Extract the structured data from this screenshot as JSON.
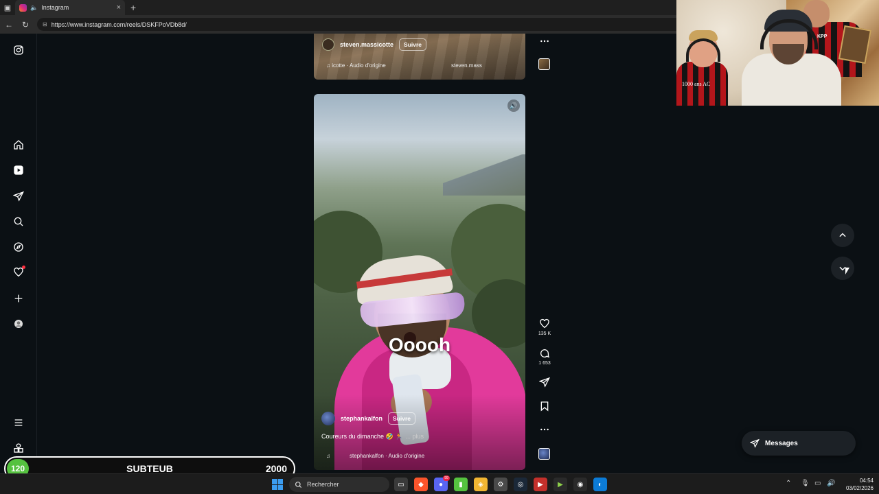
{
  "browser": {
    "tab_title": "Instagram",
    "url": "https://www.instagram.com/reels/DSKFPoVDb8d/"
  },
  "sidebar": {
    "items": [
      {
        "name": "instagram-logo-icon"
      },
      {
        "name": "home-icon"
      },
      {
        "name": "reels-icon"
      },
      {
        "name": "messages-icon"
      },
      {
        "name": "search-icon"
      },
      {
        "name": "explore-icon"
      },
      {
        "name": "notifications-icon"
      },
      {
        "name": "create-icon"
      },
      {
        "name": "profile-icon"
      },
      {
        "name": "menu-icon"
      },
      {
        "name": "also-from-meta-icon"
      }
    ]
  },
  "previous_reel": {
    "username": "steven.massicotte",
    "follow_label": "Suivre",
    "audio": "icotte · Audio d'origine",
    "audio_repeat": "steven.mass"
  },
  "reel": {
    "caption_overlay": "Ooooh",
    "username": "stephankalfon",
    "follow_label": "Suivre",
    "caption": "Coureurs du dimanche 🤣 🏃",
    "more_label": "... plus",
    "audio": "stephankalfon · Audio d'origine",
    "likes": "135 K",
    "comments": "1 653"
  },
  "messages_button": {
    "label": "Messages"
  },
  "sub_goal": {
    "current": "120",
    "label": "SUBTEUB",
    "goal": "2000"
  },
  "webcam": {
    "shirt_text": "1000 ans AC",
    "shirt_text_2": "KPP"
  },
  "taskbar": {
    "search_placeholder": "Rechercher",
    "discord_badge": "99",
    "time": "04:54",
    "date": "03/02/2026"
  },
  "colors": {
    "page_bg": "#0b1014",
    "jacket": "#e23a9b",
    "sub_counter": "#55c23f",
    "notification_dot": "#ff3040"
  }
}
